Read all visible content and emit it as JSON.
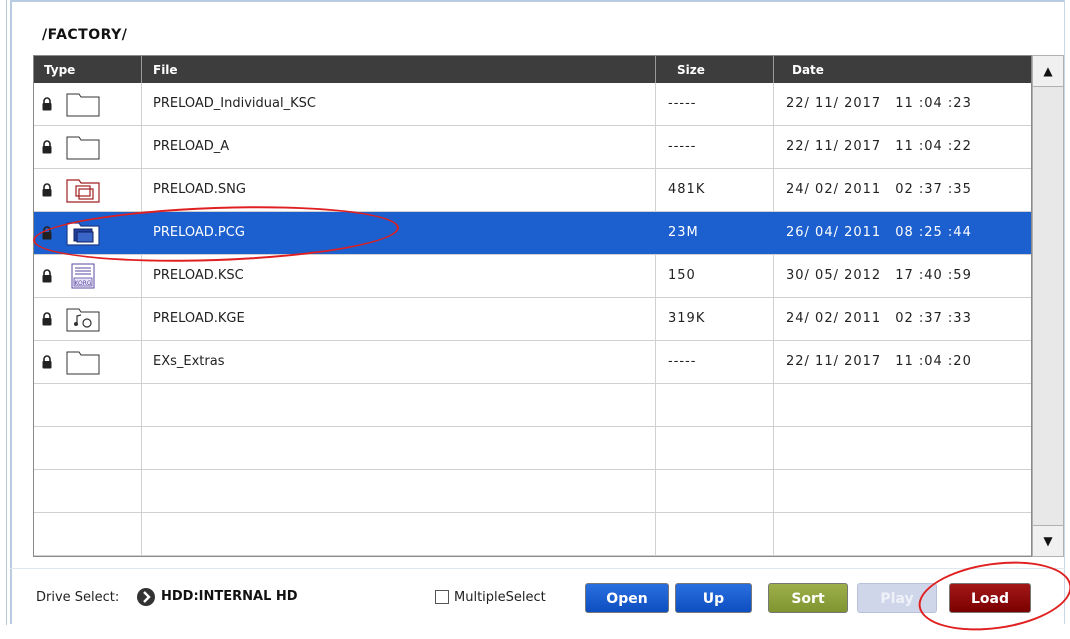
{
  "path": "/FACTORY/",
  "columns": {
    "type": "Type",
    "file": "File",
    "size": "Size",
    "date": "Date"
  },
  "rows": [
    {
      "icon": "folder-icon",
      "file": "PRELOAD_Individual_KSC",
      "size": "-----",
      "date": "22/ 11/ 2017",
      "time": "11 :04 :23",
      "selected": false
    },
    {
      "icon": "folder-icon",
      "file": "PRELOAD_A",
      "size": "-----",
      "date": "22/ 11/ 2017",
      "time": "11 :04 :22",
      "selected": false
    },
    {
      "icon": "song-file-icon",
      "file": "PRELOAD.SNG",
      "size": "481K",
      "date": "24/ 02/ 2011",
      "time": "02 :37 :35",
      "selected": false
    },
    {
      "icon": "pcg-file-icon",
      "file": "PRELOAD.PCG",
      "size": "23M",
      "date": "26/ 04/ 2011",
      "time": "08 :25 :44",
      "selected": true
    },
    {
      "icon": "korg-ksc-file-icon",
      "file": "PRELOAD.KSC",
      "size": "150",
      "date": "30/ 05/ 2012",
      "time": "17 :40 :59",
      "selected": false
    },
    {
      "icon": "kge-file-icon",
      "file": "PRELOAD.KGE",
      "size": "319K",
      "date": "24/ 02/ 2011",
      "time": "02 :37 :33",
      "selected": false
    },
    {
      "icon": "folder-icon",
      "file": "EXs_Extras",
      "size": "-----",
      "date": "22/ 11/ 2017",
      "time": "11 :04 :20",
      "selected": false
    }
  ],
  "footer": {
    "drive_label": "Drive Select:",
    "drive_value": "HDD:INTERNAL HD",
    "multiple_select_label": "MultipleSelect",
    "buttons": {
      "open": "Open",
      "up": "Up",
      "sort": "Sort",
      "play": "Play",
      "load": "Load"
    }
  },
  "colors": {
    "selection": "#1c5fce",
    "header": "#3d3d3d",
    "open_up": "#1556cc",
    "sort": "#8fa33c",
    "play_disabled": "#cfd6ea",
    "load": "#8c0c0c",
    "annotation": "#e02020"
  }
}
